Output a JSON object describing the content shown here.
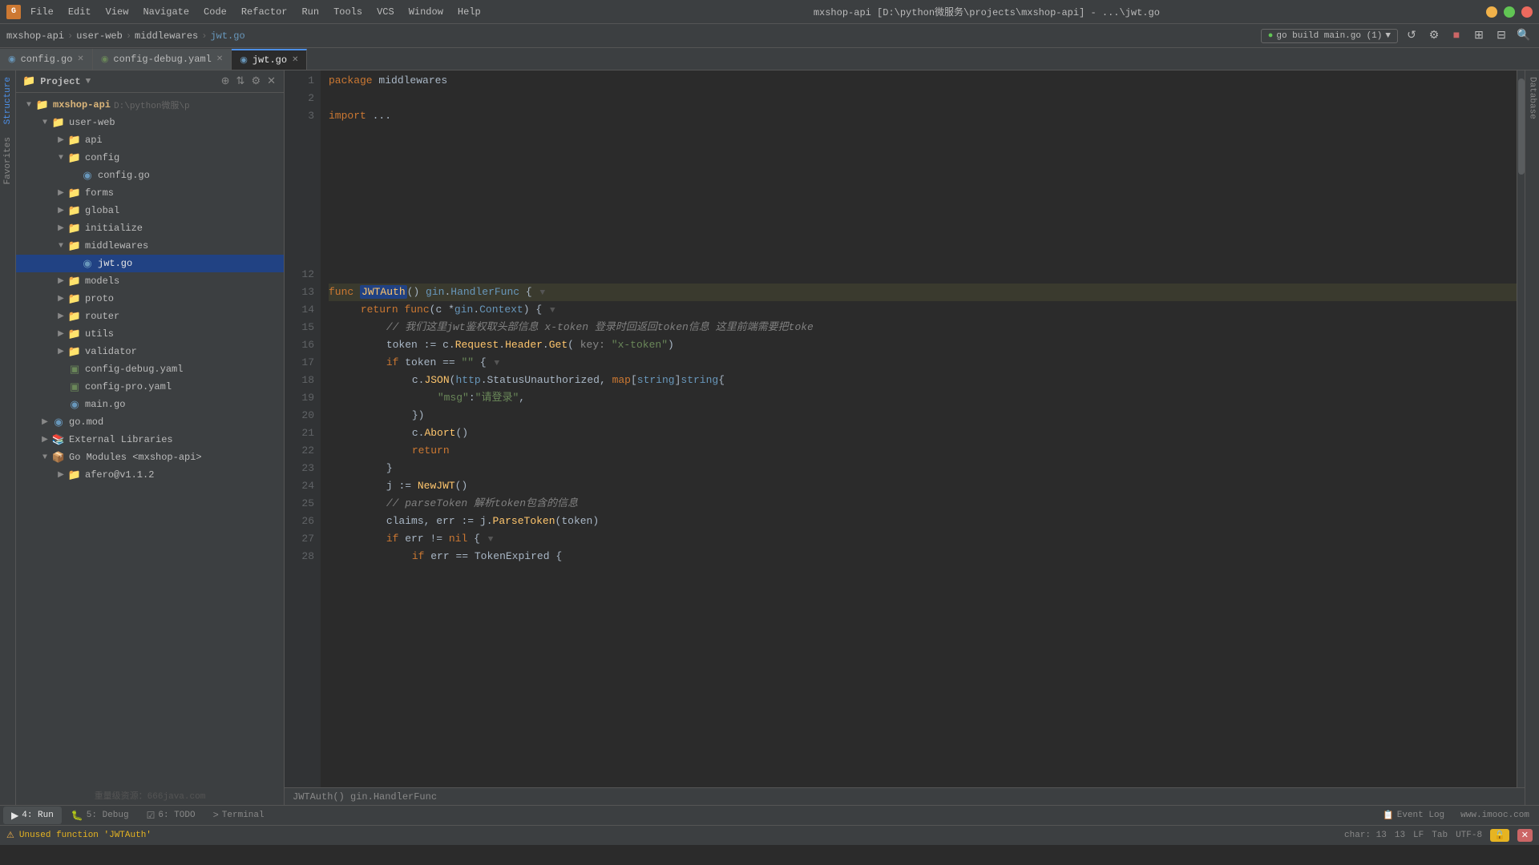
{
  "window": {
    "title": "mxshop-api [D:\\python微服务\\projects\\mxshop-api] - ...\\jwt.go",
    "app_name": "mxshop-api"
  },
  "menu": {
    "items": [
      "File",
      "Edit",
      "View",
      "Navigate",
      "Code",
      "Refactor",
      "Run",
      "Tools",
      "VCS",
      "Window",
      "Help"
    ]
  },
  "nav": {
    "breadcrumbs": [
      "mxshop-api",
      "user-web",
      "middlewares",
      "jwt.go"
    ],
    "build_label": "go build main.go (1)"
  },
  "tabs": [
    {
      "label": "config.go",
      "type": "go",
      "active": false
    },
    {
      "label": "config-debug.yaml",
      "type": "yaml",
      "active": false
    },
    {
      "label": "jwt.go",
      "type": "go",
      "active": true
    }
  ],
  "sidebar": {
    "title": "Project",
    "root": "mxshop-api",
    "root_path": "D:\\python微服\\p",
    "items": [
      {
        "name": "user-web",
        "type": "folder",
        "expanded": true,
        "indent": 1
      },
      {
        "name": "api",
        "type": "folder",
        "expanded": false,
        "indent": 2
      },
      {
        "name": "config",
        "type": "folder",
        "expanded": true,
        "indent": 2
      },
      {
        "name": "config.go",
        "type": "go",
        "indent": 3
      },
      {
        "name": "forms",
        "type": "folder",
        "expanded": false,
        "indent": 2
      },
      {
        "name": "global",
        "type": "folder",
        "expanded": false,
        "indent": 2
      },
      {
        "name": "initialize",
        "type": "folder",
        "expanded": false,
        "indent": 2
      },
      {
        "name": "middlewares",
        "type": "folder",
        "expanded": true,
        "indent": 2
      },
      {
        "name": "jwt.go",
        "type": "go",
        "indent": 3,
        "selected": true
      },
      {
        "name": "models",
        "type": "folder",
        "expanded": false,
        "indent": 2
      },
      {
        "name": "proto",
        "type": "folder",
        "expanded": false,
        "indent": 2
      },
      {
        "name": "router",
        "type": "folder",
        "expanded": false,
        "indent": 2
      },
      {
        "name": "utils",
        "type": "folder",
        "expanded": false,
        "indent": 2
      },
      {
        "name": "validator",
        "type": "folder",
        "expanded": false,
        "indent": 2
      },
      {
        "name": "config-debug.yaml",
        "type": "yaml",
        "indent": 2
      },
      {
        "name": "config-pro.yaml",
        "type": "yaml",
        "indent": 2
      },
      {
        "name": "main.go",
        "type": "go",
        "indent": 2
      }
    ],
    "extra_items": [
      {
        "name": "go.mod",
        "type": "go",
        "indent": 1
      },
      {
        "name": "External Libraries",
        "type": "lib",
        "indent": 1
      },
      {
        "name": "Go Modules <mxshop-api>",
        "type": "lib",
        "indent": 1,
        "expanded": true
      },
      {
        "name": "afero@v1.1.2",
        "type": "folder",
        "indent": 2
      }
    ]
  },
  "code": {
    "filename": "jwt.go",
    "package": "package middlewares",
    "lines": [
      {
        "num": 1,
        "content": "package middlewares",
        "type": "normal"
      },
      {
        "num": 2,
        "content": "",
        "type": "normal"
      },
      {
        "num": 3,
        "content": "import ...",
        "type": "normal"
      },
      {
        "num": 12,
        "content": "",
        "type": "normal"
      },
      {
        "num": 13,
        "content": "func JWTAuth() gin.HandlerFunc {",
        "type": "highlighted"
      },
      {
        "num": 14,
        "content": "    return func(c *gin.Context) {",
        "type": "normal"
      },
      {
        "num": 15,
        "content": "        // 我们这里jwt鉴权取头部信息 x-token 登录时回返回token信息 这里前端需要把toke",
        "type": "normal"
      },
      {
        "num": 16,
        "content": "        token := c.Request.Header.Get( key: \"x-token\")",
        "type": "normal"
      },
      {
        "num": 17,
        "content": "        if token == \"\" {",
        "type": "normal"
      },
      {
        "num": 18,
        "content": "            c.JSON(http.StatusUnauthorized, map[string]string{",
        "type": "normal"
      },
      {
        "num": 19,
        "content": "                \"msg\":\"请登录\",",
        "type": "normal"
      },
      {
        "num": 20,
        "content": "            })",
        "type": "normal"
      },
      {
        "num": 21,
        "content": "            c.Abort()",
        "type": "normal"
      },
      {
        "num": 22,
        "content": "            return",
        "type": "normal"
      },
      {
        "num": 23,
        "content": "        }",
        "type": "normal"
      },
      {
        "num": 24,
        "content": "        j := NewJWT()",
        "type": "normal"
      },
      {
        "num": 25,
        "content": "        // parseToken 解析token包含的信息",
        "type": "normal"
      },
      {
        "num": 26,
        "content": "        claims, err := j.ParseToken(token)",
        "type": "normal"
      },
      {
        "num": 27,
        "content": "        if err != nil {",
        "type": "normal"
      },
      {
        "num": 28,
        "content": "            if err == TokenExpired {",
        "type": "normal"
      }
    ]
  },
  "status_bar": {
    "unused_warning": "Unused function 'JWTAuth'",
    "char_info": "char: 13",
    "line_info": "13",
    "lf_info": "LF",
    "tab_info": "Tab",
    "encoding": "UTF-8"
  },
  "bottom_tabs": [
    {
      "label": "4: Run",
      "icon": "▶"
    },
    {
      "label": "5: Debug",
      "icon": "🐛"
    },
    {
      "label": "6: TODO",
      "icon": "☑"
    },
    {
      "label": "Terminal",
      "icon": ">"
    }
  ],
  "hint_bar": {
    "text": "JWTAuth() gin.HandlerFunc"
  },
  "right_panel": {
    "label": "Database"
  },
  "left_panels": [
    {
      "label": "Structure"
    },
    {
      "label": "Favorites"
    }
  ],
  "watermark": {
    "text": "重量级资源：666java.com"
  },
  "event_log": "Event Log"
}
